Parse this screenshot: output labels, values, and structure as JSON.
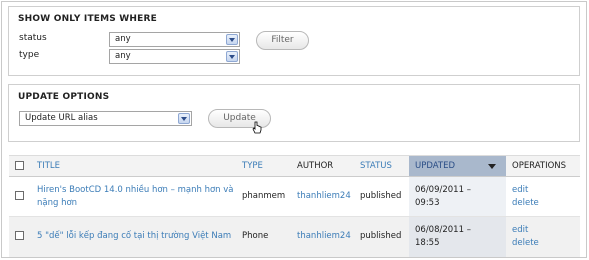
{
  "filter": {
    "legend": "SHOW ONLY ITEMS WHERE",
    "status_label": "status",
    "status_value": "any",
    "type_label": "type",
    "type_value": "any",
    "button_label": "Filter"
  },
  "update": {
    "legend": "UPDATE OPTIONS",
    "select_value": "Update URL alias",
    "button_label": "Update"
  },
  "table": {
    "headers": {
      "title": "TITLE",
      "type": "TYPE",
      "author": "AUTHOR",
      "status": "STATUS",
      "updated": "UPDATED",
      "operations": "OPERATIONS"
    },
    "rows": [
      {
        "title": "Hiren's BootCD 14.0 nhiều hơn – mạnh hơn và nặng hơn",
        "type": "phanmem",
        "author": "thanhliem24",
        "status": "published",
        "updated_date": "06/09/2011 –",
        "updated_time": "09:53",
        "edit": "edit",
        "delete": "delete"
      },
      {
        "title": "5 \"dế\" lỗi kếp đang cố tại thị trường Việt Nam",
        "type": "Phone",
        "author": "thanhliem24",
        "status": "published",
        "updated_date": "06/08/2011 –",
        "updated_time": "18:55",
        "edit": "edit",
        "delete": "delete"
      }
    ]
  },
  "colors": {
    "link": "#3b7cb7",
    "sorted_header": "#a9b8cc"
  }
}
